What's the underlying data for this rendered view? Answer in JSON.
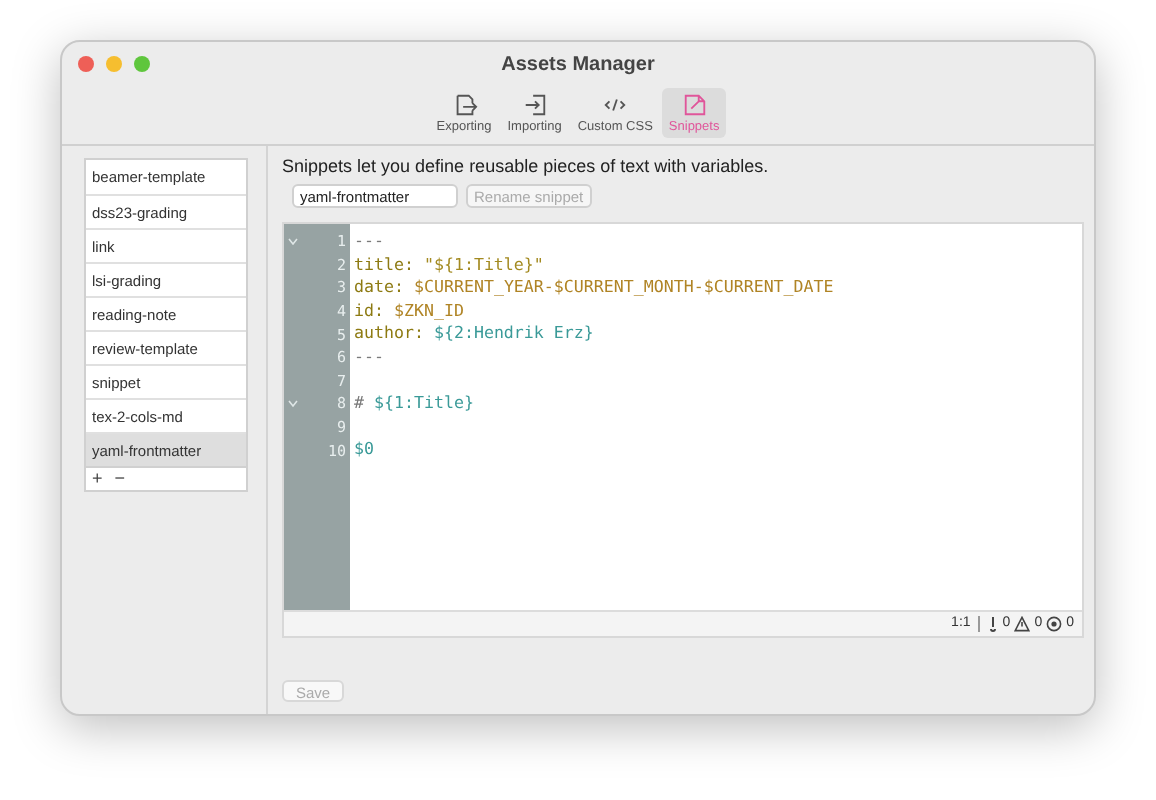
{
  "window": {
    "title": "Assets Manager"
  },
  "toolbar": [
    {
      "label": "Exporting",
      "selected": false
    },
    {
      "label": "Importing",
      "selected": false
    },
    {
      "label": "Custom CSS",
      "selected": false
    },
    {
      "label": "Snippets",
      "selected": true
    }
  ],
  "sidebar": {
    "items": [
      {
        "label": "beamer-template",
        "selected": false
      },
      {
        "label": "dss23-grading",
        "selected": false
      },
      {
        "label": "link",
        "selected": false
      },
      {
        "label": "lsi-grading",
        "selected": false
      },
      {
        "label": "reading-note",
        "selected": false
      },
      {
        "label": "review-template",
        "selected": false
      },
      {
        "label": "snippet",
        "selected": false
      },
      {
        "label": "tex-2-cols-md",
        "selected": false
      },
      {
        "label": "yaml-frontmatter",
        "selected": true
      }
    ],
    "add": "+",
    "remove": "−"
  },
  "description": "Snippets let you define reusable pieces of text with variables.",
  "name_field": {
    "value": "yaml-frontmatter"
  },
  "rename_button": {
    "label": "Rename snippet",
    "disabled": true
  },
  "editor": {
    "lines": [
      {
        "number": "1",
        "foldable": true,
        "segments": [
          {
            "kind": "plain",
            "text": "---"
          }
        ]
      },
      {
        "number": "2",
        "foldable": false,
        "segments": [
          {
            "kind": "key",
            "text": "title: "
          },
          {
            "kind": "string",
            "text": "\"${1:Title}\""
          }
        ]
      },
      {
        "number": "3",
        "foldable": false,
        "segments": [
          {
            "kind": "key",
            "text": "date: "
          },
          {
            "kind": "variable",
            "text": "$CURRENT_YEAR-$CURRENT_MONTH-$CURRENT_DATE"
          }
        ]
      },
      {
        "number": "4",
        "foldable": false,
        "segments": [
          {
            "kind": "key",
            "text": "id: "
          },
          {
            "kind": "variable",
            "text": "$ZKN_ID"
          }
        ]
      },
      {
        "number": "5",
        "foldable": false,
        "segments": [
          {
            "kind": "key",
            "text": "author: "
          },
          {
            "kind": "placeholder",
            "text": "${2:Hendrik Erz}"
          }
        ]
      },
      {
        "number": "6",
        "foldable": false,
        "segments": [
          {
            "kind": "plain",
            "text": "---"
          }
        ]
      },
      {
        "number": "7",
        "foldable": false
      },
      {
        "number": "8",
        "foldable": true,
        "segments": [
          {
            "kind": "plain",
            "text": "# "
          },
          {
            "kind": "placeholder",
            "text": "${1:Title}"
          }
        ]
      },
      {
        "number": "9",
        "foldable": false
      },
      {
        "number": "10",
        "foldable": false,
        "segments": [
          {
            "kind": "placeholder",
            "text": "$0"
          }
        ]
      }
    ],
    "status": {
      "cursor": "1:1",
      "words": "0",
      "warnings": "0",
      "errors": "0"
    }
  },
  "save_button": {
    "label": "Save",
    "disabled": true
  }
}
